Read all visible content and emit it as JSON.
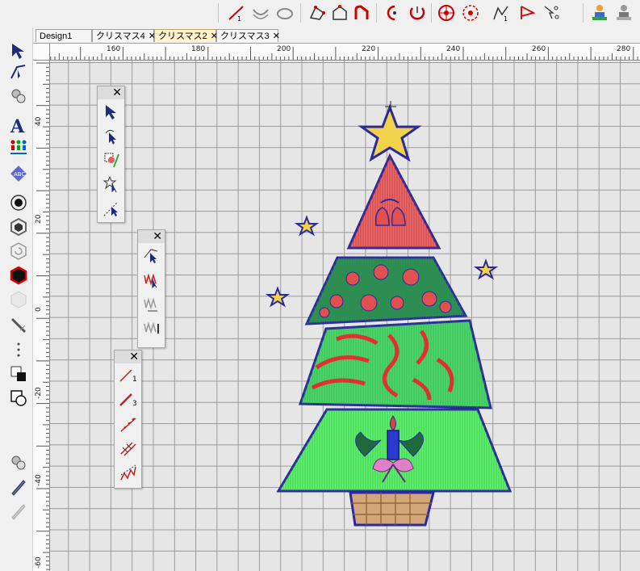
{
  "tabs": [
    {
      "label": "Design1",
      "active": false
    },
    {
      "label": "クリスマス4",
      "active": false
    },
    {
      "label": "クリスマス2",
      "active": true
    },
    {
      "label": "クリスマス3",
      "active": false
    }
  ],
  "tab_close_glyph": "✕",
  "ruler_top_labels": [
    "160",
    "180",
    "200",
    "220",
    "240",
    "260",
    "280"
  ],
  "ruler_left_labels": [
    "40",
    "20",
    "0",
    "-20",
    "-40",
    "-60"
  ],
  "panels": {
    "select": {
      "close": "✕"
    },
    "stitch": {
      "close": "✕"
    },
    "run": {
      "close": "✕",
      "items": [
        "1",
        "3"
      ]
    }
  },
  "colors": {
    "outline": "#2a2a9e",
    "tree_top": "#e05c5c",
    "tree_mid": "#2e8b57",
    "tree_low": "#4cd66c",
    "star": "#f2d24a",
    "pot": "#d2a679"
  }
}
